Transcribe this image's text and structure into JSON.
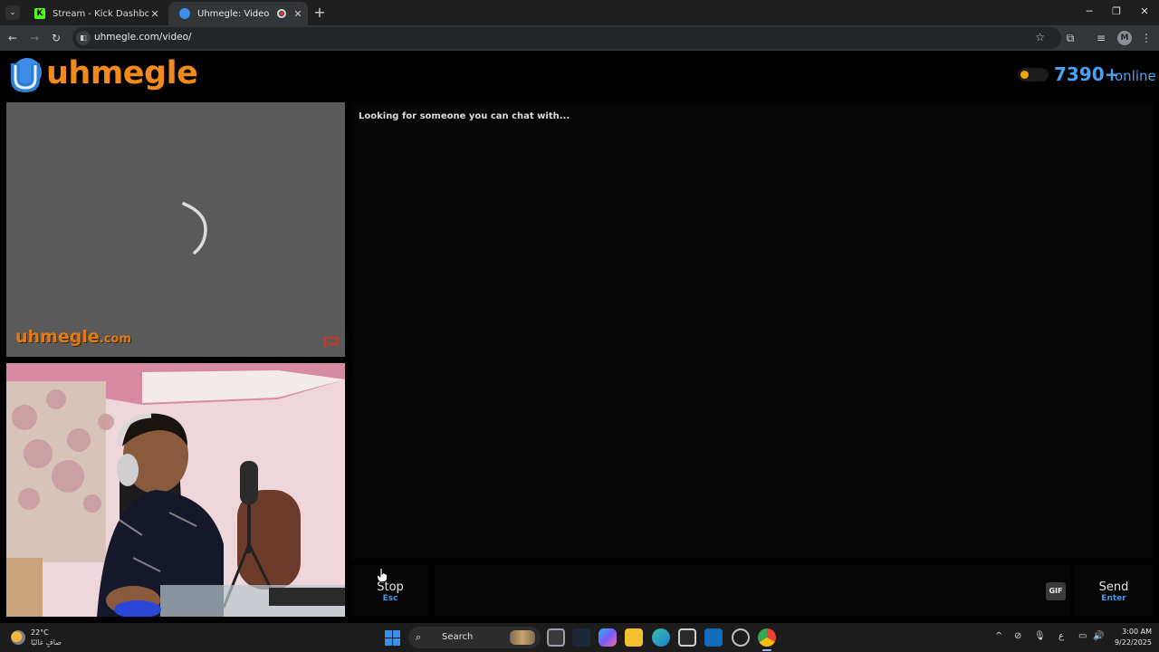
{
  "browser": {
    "tabs": [
      {
        "label": "Stream - Kick Dashboard",
        "favicon": "kick-icon",
        "favicon_letter": "K",
        "active": false
      },
      {
        "label": "Uhmegle: Video Chat | Ome",
        "favicon": "uhmegle-icon",
        "active": true
      }
    ],
    "new_tab_glyph": "+",
    "url": "uhmegle.com/video/",
    "profile_initial": "M"
  },
  "site": {
    "logo_text": "uhmegle",
    "online_count": "7390+",
    "online_label": "online",
    "colors": {
      "brand_orange": "#f08a1d",
      "brand_blue": "#4aa3f0",
      "status_dot": "#f0a500"
    }
  },
  "video": {
    "watermark_main": "uhmegle",
    "watermark_suffix": ".com"
  },
  "chat": {
    "status": "Looking for someone you can chat with...",
    "message_value": "",
    "stop_label": "Stop",
    "stop_hint": "Esc",
    "gif_label": "GIF",
    "send_label": "Send",
    "send_hint": "Enter"
  },
  "taskbar": {
    "weather_temp": "22°C",
    "weather_desc": "صافٍ غالبًا",
    "search_label": "Search",
    "lang_indicator": "ع",
    "time": "3:00 AM",
    "date": "9/22/2025"
  }
}
